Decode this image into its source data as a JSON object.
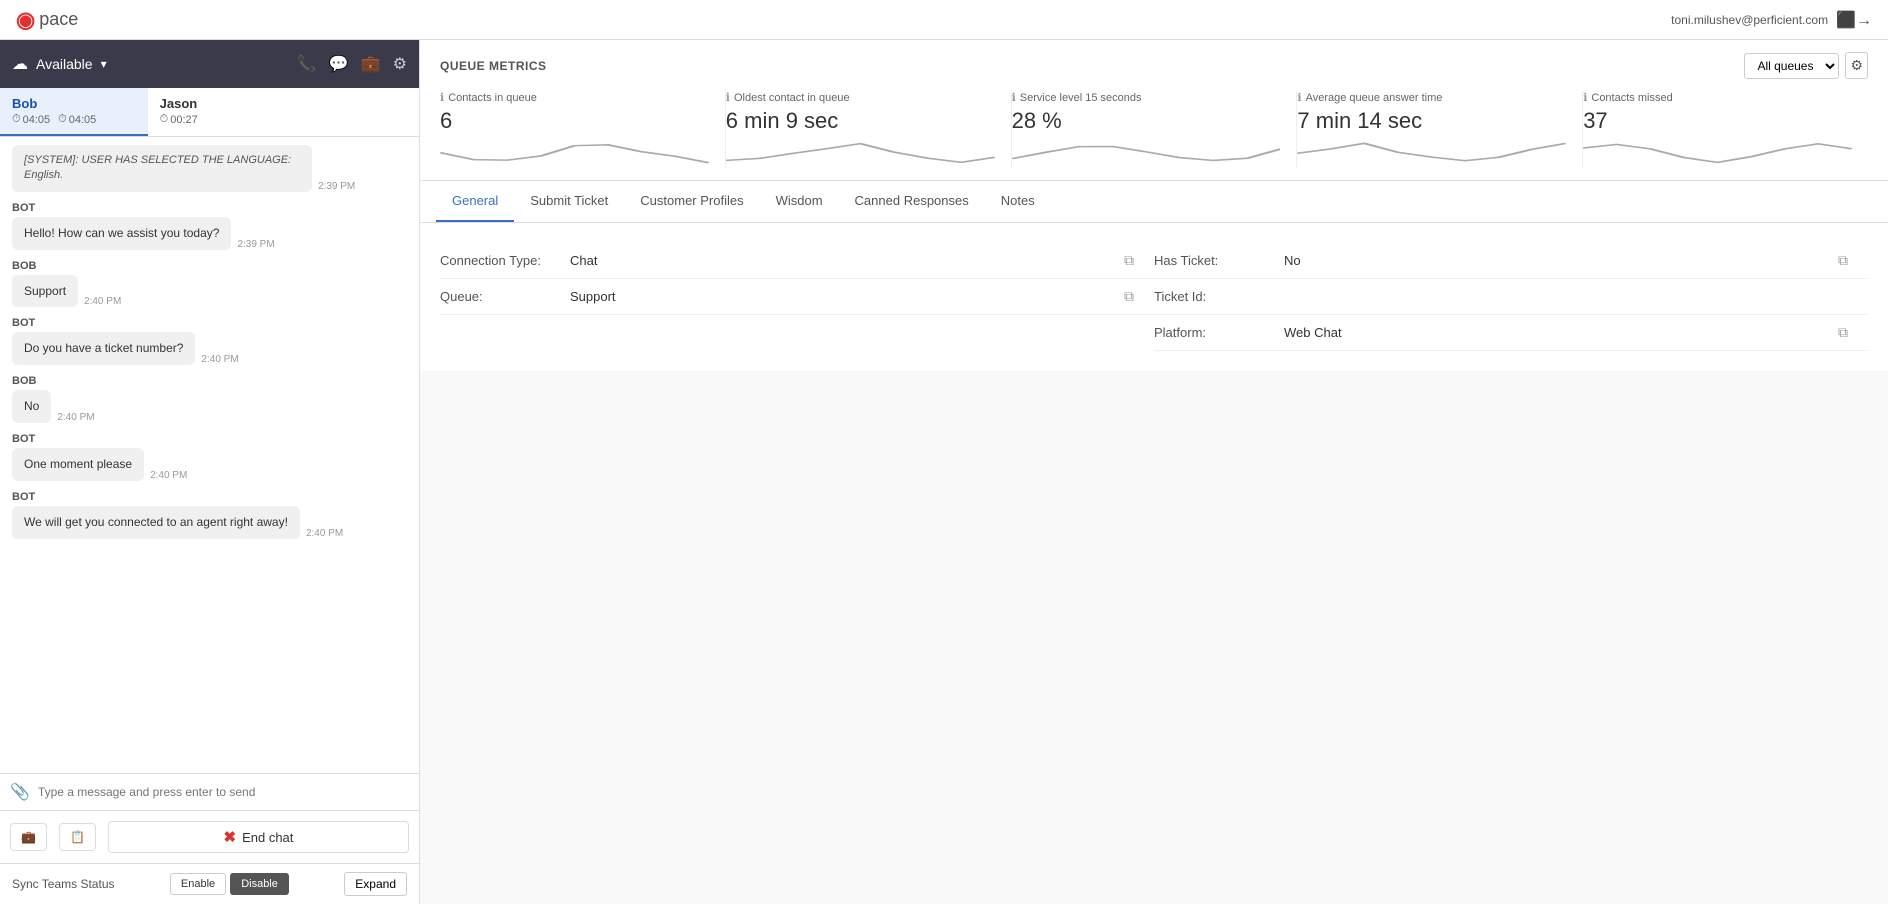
{
  "app": {
    "logo_icon": "◉",
    "logo_text": "pace",
    "user_email": "toni.milushev@perficient.com"
  },
  "status_bar": {
    "status_label": "Available",
    "cloud_icon": "☁",
    "dropdown_icon": "▾"
  },
  "chat_tabs": [
    {
      "name": "Bob",
      "time1": "04:05",
      "time2": "04:05",
      "active": true
    },
    {
      "name": "Jason",
      "time1": "00:27",
      "active": false
    }
  ],
  "messages": [
    {
      "sender": "SYSTEM",
      "text": "[SYSTEM]: USER HAS SELECTED THE LANGUAGE: English.",
      "time": "2:39 PM",
      "type": "system"
    },
    {
      "sender": "BOT",
      "text": "Hello! How can we assist you today?",
      "time": "2:39 PM",
      "type": "bot"
    },
    {
      "sender": "Bob",
      "text": "Support",
      "time": "2:40 PM",
      "type": "user"
    },
    {
      "sender": "BOT",
      "text": "Do you have a ticket number?",
      "time": "2:40 PM",
      "type": "bot"
    },
    {
      "sender": "Bob",
      "text": "No",
      "time": "2:40 PM",
      "type": "user"
    },
    {
      "sender": "BOT",
      "text": "One moment please",
      "time": "2:40 PM",
      "type": "bot"
    },
    {
      "sender": "BOT",
      "text": "We will get you connected to an agent right away!",
      "time": "2:40 PM",
      "type": "bot"
    }
  ],
  "chat_input": {
    "placeholder": "Type a message and press enter to send"
  },
  "chat_actions": {
    "end_chat_label": "End chat"
  },
  "sync_bar": {
    "label": "Sync Teams Status",
    "enable_label": "Enable",
    "disable_label": "Disable",
    "expand_label": "Expand"
  },
  "queue_metrics": {
    "title": "QUEUE METRICS",
    "selector_default": "All queues",
    "metrics": [
      {
        "label": "Contacts in queue",
        "value": "6"
      },
      {
        "label": "Oldest contact in queue",
        "value": "6 min 9 sec"
      },
      {
        "label": "Service level 15 seconds",
        "value": "28 %"
      },
      {
        "label": "Average queue answer time",
        "value": "7 min 14 sec"
      },
      {
        "label": "Contacts missed",
        "value": "37"
      }
    ]
  },
  "content_tabs": [
    {
      "label": "General",
      "active": true
    },
    {
      "label": "Submit Ticket",
      "active": false
    },
    {
      "label": "Customer Profiles",
      "active": false
    },
    {
      "label": "Wisdom",
      "active": false
    },
    {
      "label": "Canned Responses",
      "active": false
    },
    {
      "label": "Notes",
      "active": false
    }
  ],
  "general_info": {
    "left": [
      {
        "label": "Connection Type:",
        "value": "Chat",
        "copyable": true
      },
      {
        "label": "Queue:",
        "value": "Support",
        "copyable": true
      }
    ],
    "right": [
      {
        "label": "Has Ticket:",
        "value": "No",
        "copyable": true
      },
      {
        "label": "Ticket Id:",
        "value": "",
        "copyable": false
      },
      {
        "label": "Platform:",
        "value": "Web Chat",
        "copyable": true
      }
    ]
  }
}
